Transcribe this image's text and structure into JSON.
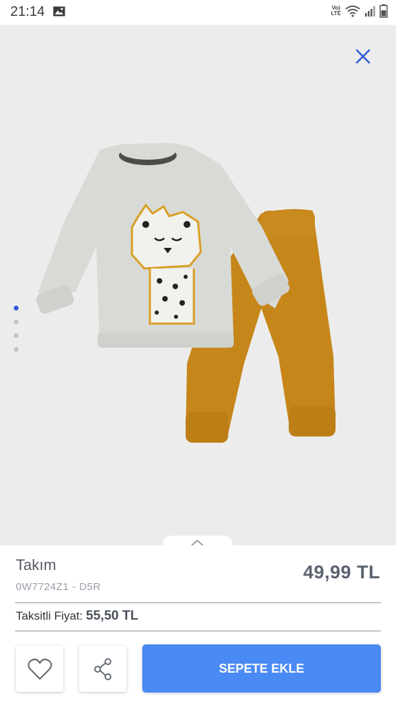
{
  "status_bar": {
    "time": "21:14",
    "network_top": "Vo)",
    "network_bottom": "LTE",
    "icons": [
      "image-icon",
      "lte-icon",
      "wifi-icon",
      "signal-icon",
      "battery-icon"
    ]
  },
  "gallery": {
    "close_icon": "close-icon",
    "accent": "#2e5bd6",
    "page_count": 4,
    "active_index": 0
  },
  "product": {
    "title": "Takım",
    "code": "0W7724Z1 - D5R",
    "price": "49,99 TL",
    "installment_label": "Taksitli Fiyat:",
    "installment_value": "55,50 TL"
  },
  "actions": {
    "favorite_icon": "heart-icon",
    "share_icon": "share-icon",
    "add_to_cart": "SEPETE EKLE",
    "add_to_cart_color": "#4a8af4"
  }
}
